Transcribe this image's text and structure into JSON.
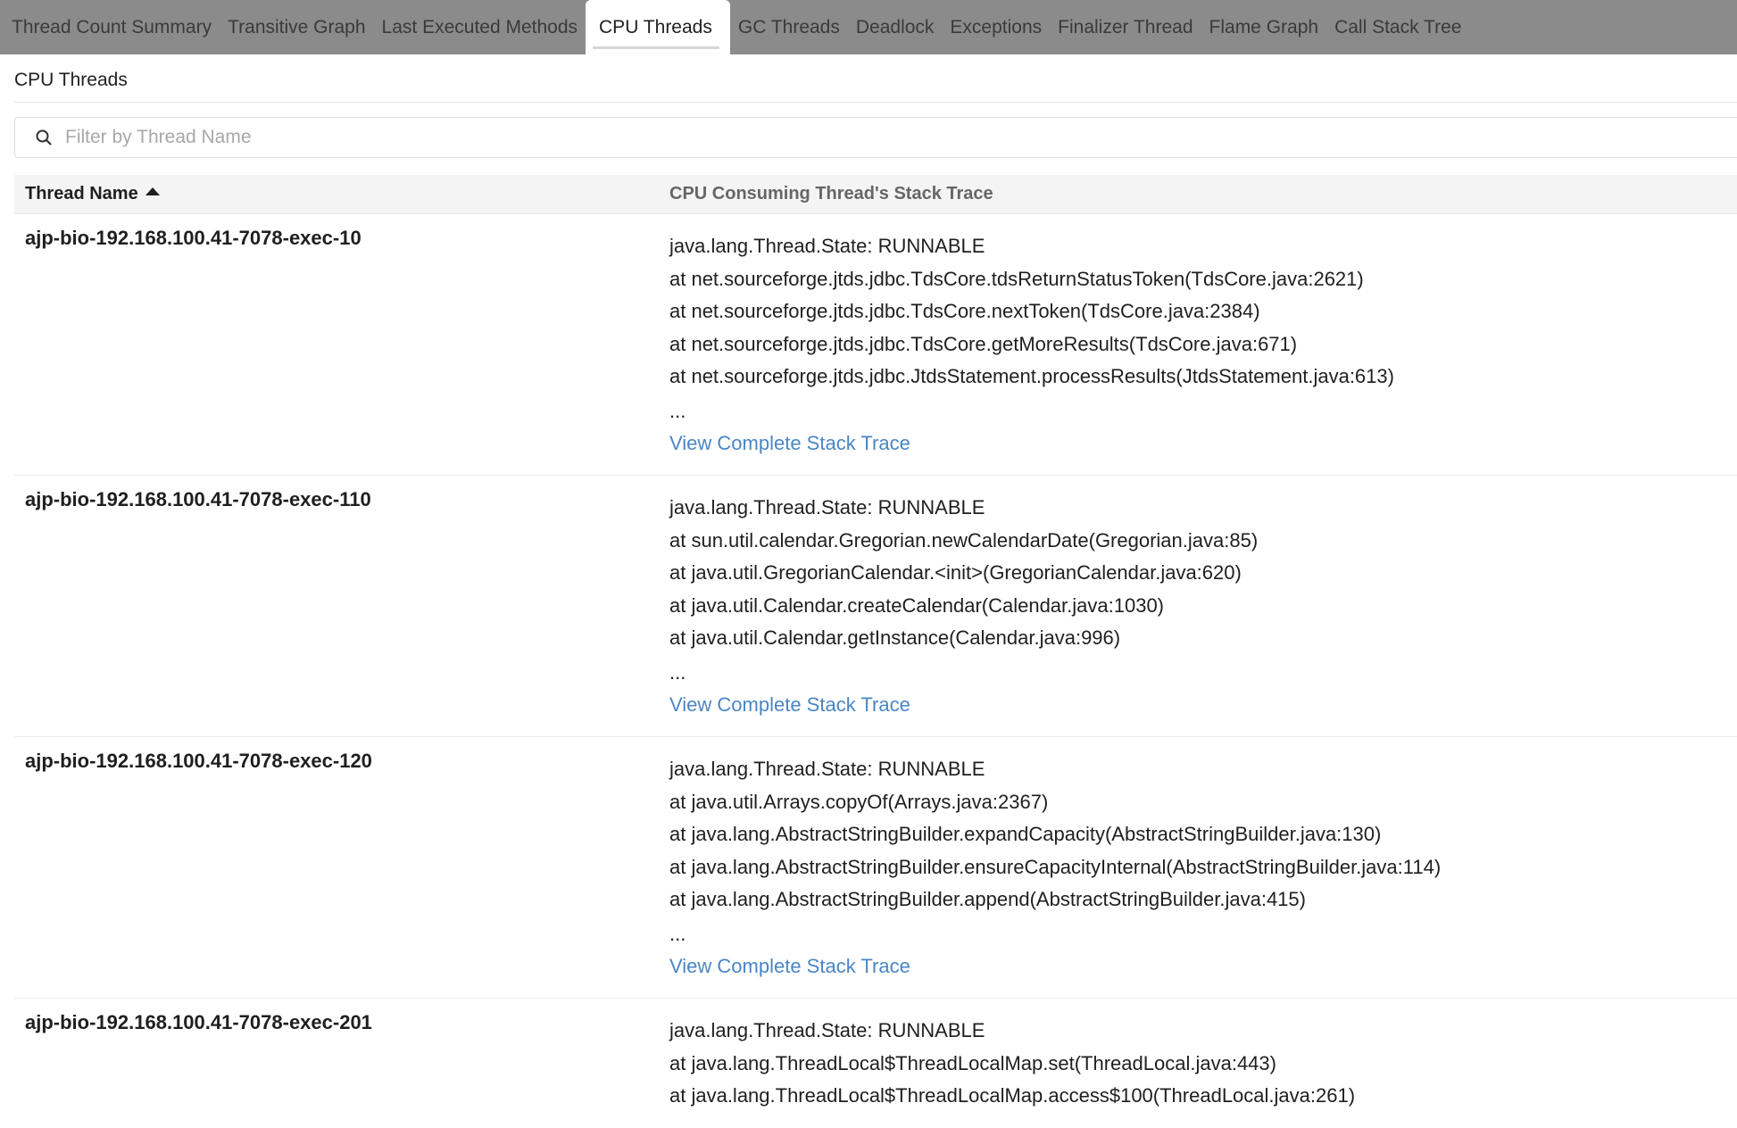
{
  "tabs": [
    {
      "label": "Thread Count Summary",
      "active": false
    },
    {
      "label": "Transitive Graph",
      "active": false
    },
    {
      "label": "Last Executed Methods",
      "active": false
    },
    {
      "label": "CPU Threads",
      "active": true
    },
    {
      "label": "GC Threads",
      "active": false
    },
    {
      "label": "Deadlock",
      "active": false
    },
    {
      "label": "Exceptions",
      "active": false
    },
    {
      "label": "Finalizer Thread",
      "active": false
    },
    {
      "label": "Flame Graph",
      "active": false
    },
    {
      "label": "Call Stack Tree",
      "active": false
    }
  ],
  "section": {
    "title": "CPU Threads"
  },
  "search": {
    "placeholder": "Filter by Thread Name",
    "value": ""
  },
  "table": {
    "columns": {
      "thread_name": "Thread Name",
      "stack_trace": "CPU Consuming Thread's Stack Trace"
    },
    "sort": {
      "column": "thread_name",
      "direction": "ascending"
    },
    "ellipsis": "...",
    "view_link": "View Complete Stack Trace",
    "rows": [
      {
        "name": "ajp-bio-192.168.100.41-7078-exec-10",
        "trace": [
          "java.lang.Thread.State: RUNNABLE",
          "at net.sourceforge.jtds.jdbc.TdsCore.tdsReturnStatusToken(TdsCore.java:2621)",
          "at net.sourceforge.jtds.jdbc.TdsCore.nextToken(TdsCore.java:2384)",
          "at net.sourceforge.jtds.jdbc.TdsCore.getMoreResults(TdsCore.java:671)",
          "at net.sourceforge.jtds.jdbc.JtdsStatement.processResults(JtdsStatement.java:613)"
        ]
      },
      {
        "name": "ajp-bio-192.168.100.41-7078-exec-110",
        "trace": [
          "java.lang.Thread.State: RUNNABLE",
          "at sun.util.calendar.Gregorian.newCalendarDate(Gregorian.java:85)",
          "at java.util.GregorianCalendar.<init>(GregorianCalendar.java:620)",
          "at java.util.Calendar.createCalendar(Calendar.java:1030)",
          "at java.util.Calendar.getInstance(Calendar.java:996)"
        ]
      },
      {
        "name": "ajp-bio-192.168.100.41-7078-exec-120",
        "trace": [
          "java.lang.Thread.State: RUNNABLE",
          "at java.util.Arrays.copyOf(Arrays.java:2367)",
          "at java.lang.AbstractStringBuilder.expandCapacity(AbstractStringBuilder.java:130)",
          "at java.lang.AbstractStringBuilder.ensureCapacityInternal(AbstractStringBuilder.java:114)",
          "at java.lang.AbstractStringBuilder.append(AbstractStringBuilder.java:415)"
        ]
      },
      {
        "name": "ajp-bio-192.168.100.41-7078-exec-201",
        "trace": [
          "java.lang.Thread.State: RUNNABLE",
          "at java.lang.ThreadLocal$ThreadLocalMap.set(ThreadLocal.java:443)",
          "at java.lang.ThreadLocal$ThreadLocalMap.access$100(ThreadLocal.java:261)"
        ]
      }
    ]
  },
  "icons": {
    "search": "search-icon",
    "sort": "sort-ascending-icon"
  }
}
